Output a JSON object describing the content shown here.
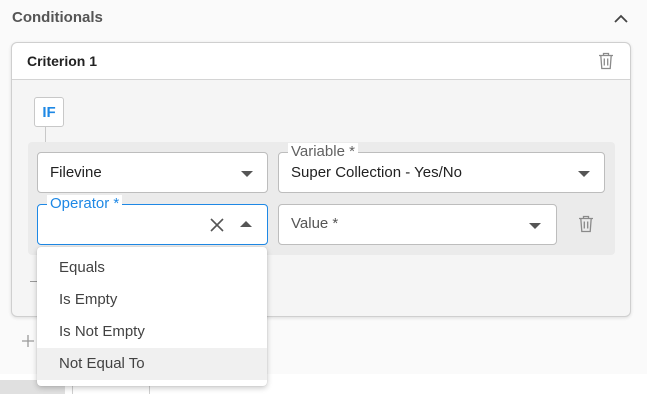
{
  "section": {
    "title": "Conditionals"
  },
  "criterion": {
    "title": "Criterion 1",
    "if_label": "IF"
  },
  "fields": {
    "source": {
      "value": "Filevine"
    },
    "variable": {
      "label": "Variable *",
      "value": "Super Collection - Yes/No"
    },
    "operator": {
      "label": "Operator *",
      "value": ""
    },
    "value": {
      "placeholder": "Value *"
    }
  },
  "operator_options": [
    {
      "label": "Equals"
    },
    {
      "label": "Is Empty"
    },
    {
      "label": "Is Not Empty"
    },
    {
      "label": "Not Equal To"
    }
  ],
  "icons": {
    "collapse": "chevron-up-icon",
    "delete": "trash-icon",
    "clear": "close-icon",
    "add": "plus-icon"
  },
  "colors": {
    "accent": "#1e88e5",
    "hover": "#f0f0f0"
  }
}
